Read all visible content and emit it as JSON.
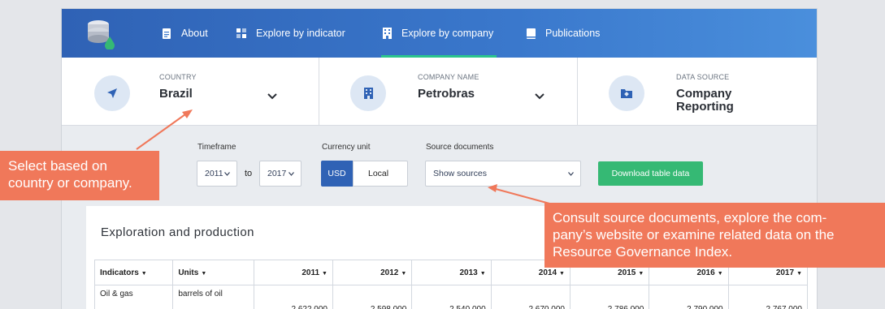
{
  "nav": {
    "items": [
      {
        "label": "About",
        "icon": "document-icon"
      },
      {
        "label": "Explore by indicator",
        "icon": "grid-icon"
      },
      {
        "label": "Explore by company",
        "icon": "building-icon"
      },
      {
        "label": "Publications",
        "icon": "book-icon"
      }
    ],
    "active": "Explore by company"
  },
  "selectors": {
    "country": {
      "label": "COUNTRY",
      "value": "Brazil"
    },
    "company": {
      "label": "COMPANY NAME",
      "value": "Petrobras"
    },
    "source": {
      "label": "DATA SOURCE",
      "value_line1": "Company",
      "value_line2": "Reporting"
    }
  },
  "filters": {
    "timeframe_label": "Timeframe",
    "from_year": "2011",
    "to_label": "to",
    "to_year": "2017",
    "currency_label": "Currency unit",
    "currency_usd": "USD",
    "currency_local": "Local",
    "currency_selected": "USD",
    "source_docs_label": "Source documents",
    "source_docs_value": "Show sources",
    "download_label": "Download table data"
  },
  "card": {
    "title": "Exploration and production",
    "columns": [
      "Indicators",
      "Units",
      "2011",
      "2012",
      "2013",
      "2014",
      "2015",
      "2016",
      "2017"
    ],
    "rows": [
      {
        "indicator": "Oil & gas",
        "units": "barrels of oil",
        "values": [
          "2,622,000",
          "2,598,000",
          "2,540,000",
          "2,670,000",
          "2,786,000",
          "2,790,000",
          "2,767,000"
        ]
      }
    ]
  },
  "callouts": {
    "left_line1": "Select based on",
    "left_line2": "country or company.",
    "right_line1": "Consult source documents, explore the com-",
    "right_line2": "pany’s website or examine related data on the",
    "right_line3": "Resource Governance Index."
  },
  "colors": {
    "nav_blue": "#2f62b5",
    "active_underline": "#2bc58c",
    "download_green": "#35b974",
    "callout_orange": "#f0785a"
  }
}
